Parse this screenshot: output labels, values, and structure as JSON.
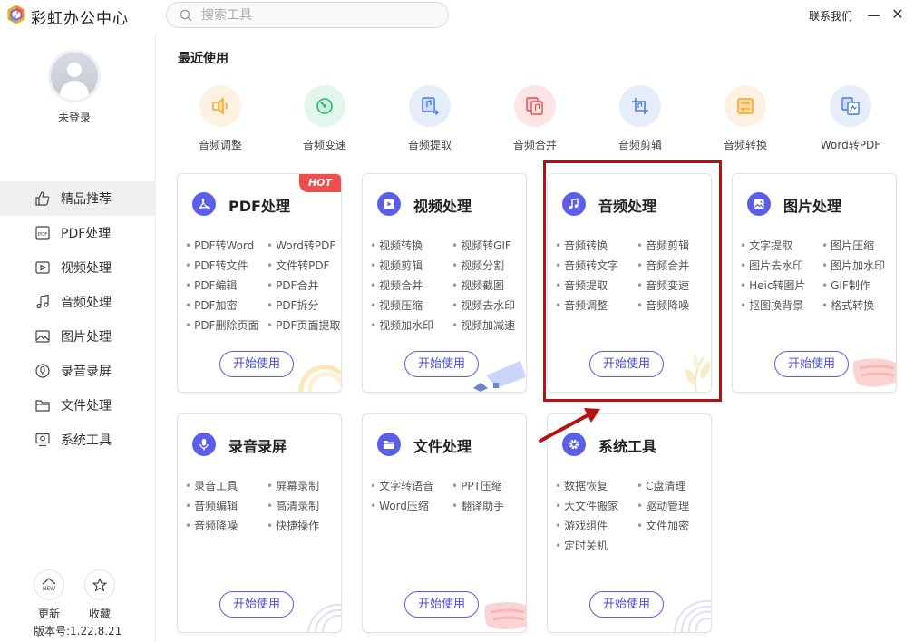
{
  "app": {
    "title": "彩虹办公中心"
  },
  "search": {
    "placeholder": "搜索工具"
  },
  "header": {
    "contact": "联系我们"
  },
  "user": {
    "status": "未登录"
  },
  "sidebar": {
    "items": [
      {
        "label": "精品推荐",
        "icon": "thumbs-up-icon",
        "active": true
      },
      {
        "label": "PDF处理",
        "icon": "pdf-icon"
      },
      {
        "label": "视频处理",
        "icon": "video-icon"
      },
      {
        "label": "音频处理",
        "icon": "music-icon"
      },
      {
        "label": "图片处理",
        "icon": "image-icon"
      },
      {
        "label": "录音录屏",
        "icon": "mic-icon"
      },
      {
        "label": "文件处理",
        "icon": "folder-icon"
      },
      {
        "label": "系统工具",
        "icon": "monitor-icon"
      }
    ],
    "update_label": "更新",
    "update_badge": "NEW",
    "favorite_label": "收藏",
    "version": "版本号:1.22.8.21"
  },
  "recent": {
    "title": "最近使用",
    "items": [
      {
        "label": "音频调整",
        "icon": "volume-icon",
        "color": "#f5a623",
        "bg": "#fdf1e2"
      },
      {
        "label": "音频变速",
        "icon": "speed-gauge-icon",
        "color": "#2bb673",
        "bg": "#e3f6ec"
      },
      {
        "label": "音频提取",
        "icon": "extract-icon",
        "color": "#4a7bdc",
        "bg": "#e5edfb"
      },
      {
        "label": "音频合并",
        "icon": "merge-icon",
        "color": "#e85050",
        "bg": "#fde5e5"
      },
      {
        "label": "音频剪辑",
        "icon": "crop-icon",
        "color": "#4a7bdc",
        "bg": "#e5edfb"
      },
      {
        "label": "音频转换",
        "icon": "convert-icon",
        "color": "#f5a623",
        "bg": "#fdf1e2"
      },
      {
        "label": "Word转PDF",
        "icon": "word-pdf-icon",
        "color": "#4a7bdc",
        "bg": "#e5edfb"
      }
    ]
  },
  "cards": [
    {
      "title": "PDF处理",
      "icon": "pdf-icon",
      "hot": "HOT",
      "start": "开始使用",
      "items": [
        "PDF转Word",
        "Word转PDF",
        "PDF转文件",
        "文件转PDF",
        "PDF编辑",
        "PDF合并",
        "PDF加密",
        "PDF拆分",
        "PDF删除页面",
        "PDF页面提取"
      ]
    },
    {
      "title": "视频处理",
      "icon": "video-icon",
      "start": "开始使用",
      "items": [
        "视频转换",
        "视频转GIF",
        "视频剪辑",
        "视频分割",
        "视频合并",
        "视频截图",
        "视频压缩",
        "视频去水印",
        "视频加水印",
        "视频加减速"
      ]
    },
    {
      "title": "音频处理",
      "icon": "music-icon",
      "start": "开始使用",
      "items": [
        "音频转换",
        "音频剪辑",
        "音频转文字",
        "音频合并",
        "音频提取",
        "音频变速",
        "音频调整",
        "音频降噪"
      ]
    },
    {
      "title": "图片处理",
      "icon": "image-icon",
      "start": "开始使用",
      "items": [
        "文字提取",
        "图片压缩",
        "图片去水印",
        "图片加水印",
        "Heic转图片",
        "GIF制作",
        "抠图换背景",
        "格式转换"
      ]
    },
    {
      "title": "录音录屏",
      "icon": "mic-icon",
      "start": "开始使用",
      "items": [
        "录音工具",
        "屏幕录制",
        "音频编辑",
        "高清录制",
        "音频降噪",
        "快捷操作"
      ]
    },
    {
      "title": "文件处理",
      "icon": "folder-icon",
      "start": "开始使用",
      "items": [
        "文字转语音",
        "PPT压缩",
        "Word压缩",
        "翻译助手"
      ]
    },
    {
      "title": "系统工具",
      "icon": "gear-icon",
      "start": "开始使用",
      "items": [
        "数据恢复",
        "C盘清理",
        "大文件搬家",
        "驱动管理",
        "游戏组件",
        "文件加密",
        "定时关机"
      ]
    }
  ],
  "colors": {
    "accent": "#5b5ee6",
    "highlight": "#b31212",
    "hot": "#f04d4d"
  }
}
